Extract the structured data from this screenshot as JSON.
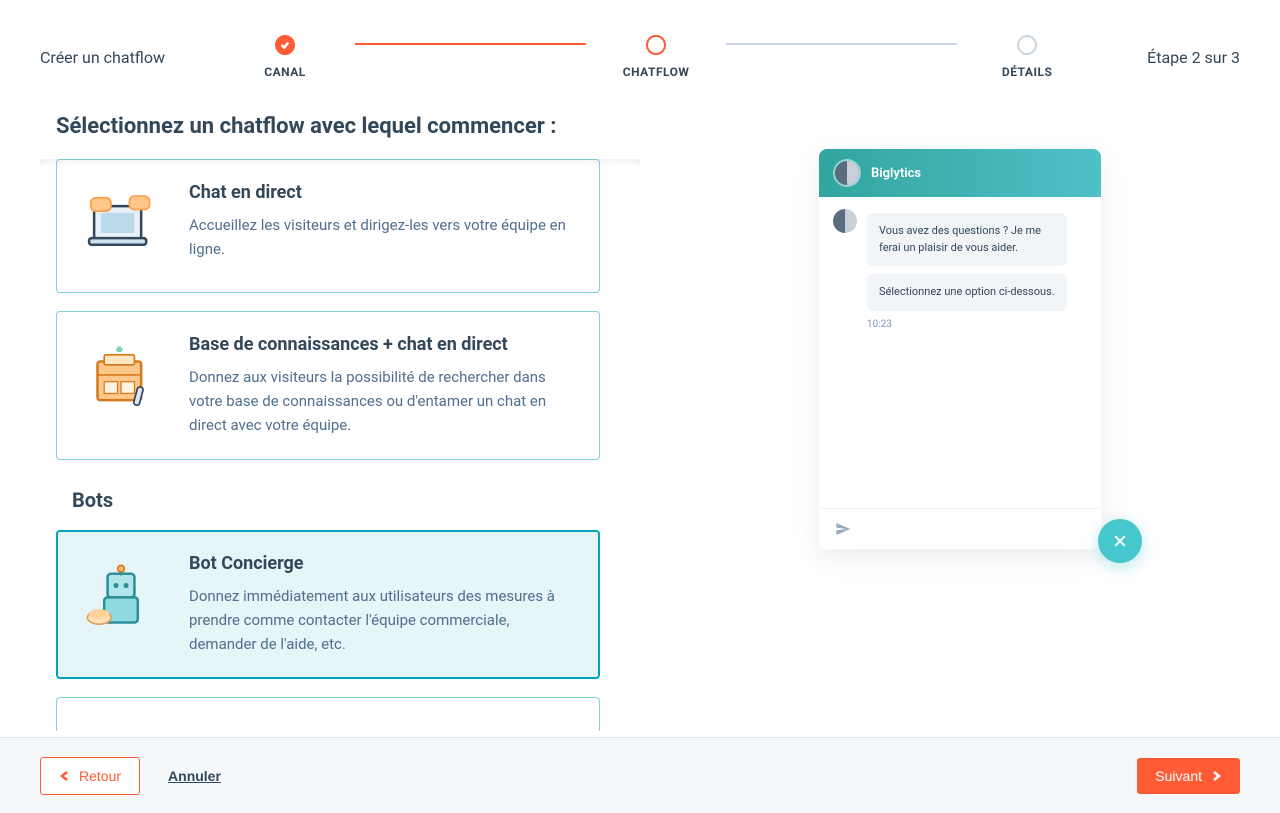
{
  "header": {
    "title": "Créer un chatflow",
    "step_indicator": "Étape 2 sur 3",
    "steps": [
      {
        "label": "CANAL",
        "state": "complete"
      },
      {
        "label": "CHATFLOW",
        "state": "current"
      },
      {
        "label": "DÉTAILS",
        "state": "pending"
      }
    ]
  },
  "main": {
    "section_title": "Sélectionnez un chatflow avec lequel commencer :",
    "cards": [
      {
        "title": "Chat en direct",
        "desc": "Accueillez les visiteurs et dirigez-les vers votre équipe en ligne.",
        "selected": false
      },
      {
        "title": "Base de connaissances + chat en direct",
        "desc": "Donnez aux visiteurs la possibilité de rechercher dans votre base de connaissances ou d'entamer un chat en direct avec votre équipe.",
        "selected": false
      }
    ],
    "bots_label": "Bots",
    "bot_cards": [
      {
        "title": "Bot Concierge",
        "desc": "Donnez immédiatement aux utilisateurs des mesures à prendre comme contacter l'équipe commerciale, demander de l'aide, etc.",
        "selected": true
      }
    ]
  },
  "preview": {
    "header_name": "Biglytics",
    "msg1": "Vous avez des questions ? Je me ferai un plaisir de vous aider.",
    "msg2": "Sélectionnez une option ci-dessous.",
    "time": "10:23"
  },
  "footer": {
    "back": "Retour",
    "cancel": "Annuler",
    "next": "Suivant"
  }
}
